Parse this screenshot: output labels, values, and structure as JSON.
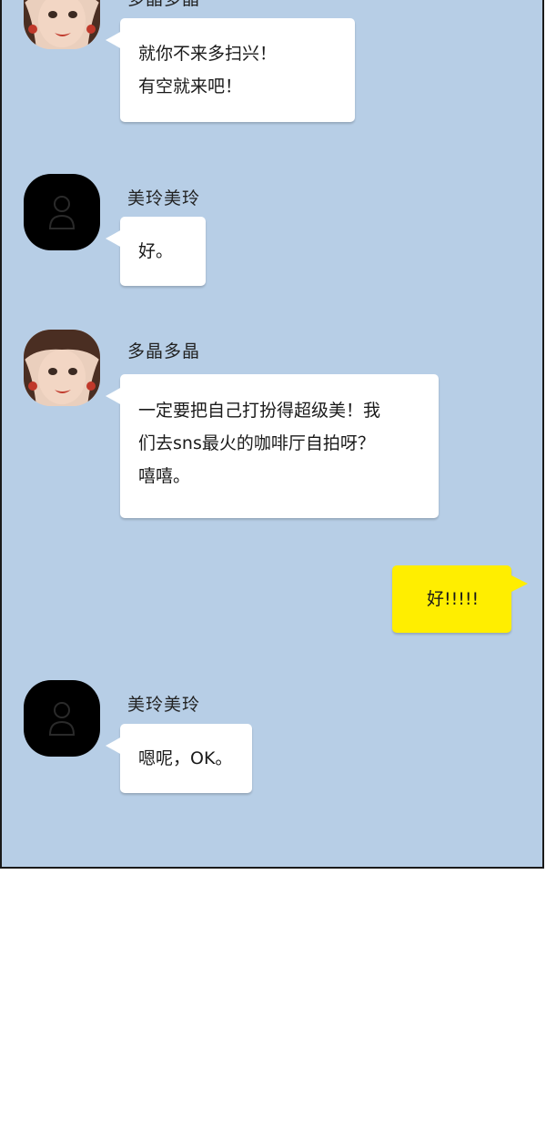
{
  "colors": {
    "chat_background": "#b7cee6",
    "incoming_bubble": "#ffffff",
    "outgoing_bubble": "#ffee00"
  },
  "messages": [
    {
      "sender": "多晶多晶",
      "avatar": "girl-avatar",
      "lines": [
        "就你不来多扫兴！",
        "有空就来吧！"
      ]
    },
    {
      "sender": "美玲美玲",
      "avatar": "default-person-icon",
      "lines": [
        "好。"
      ]
    },
    {
      "sender": "多晶多晶",
      "avatar": "girl-avatar",
      "lines": [
        "一定要把自己打扮得超级美！我",
        "们去sns最火的咖啡厅自拍呀？",
        "嘻嘻。"
      ]
    },
    {
      "sender": "",
      "avatar": "",
      "lines": [
        "好!!!!!"
      ]
    },
    {
      "sender": "美玲美玲",
      "avatar": "default-person-icon",
      "lines": [
        "嗯呢，OK。"
      ]
    }
  ]
}
